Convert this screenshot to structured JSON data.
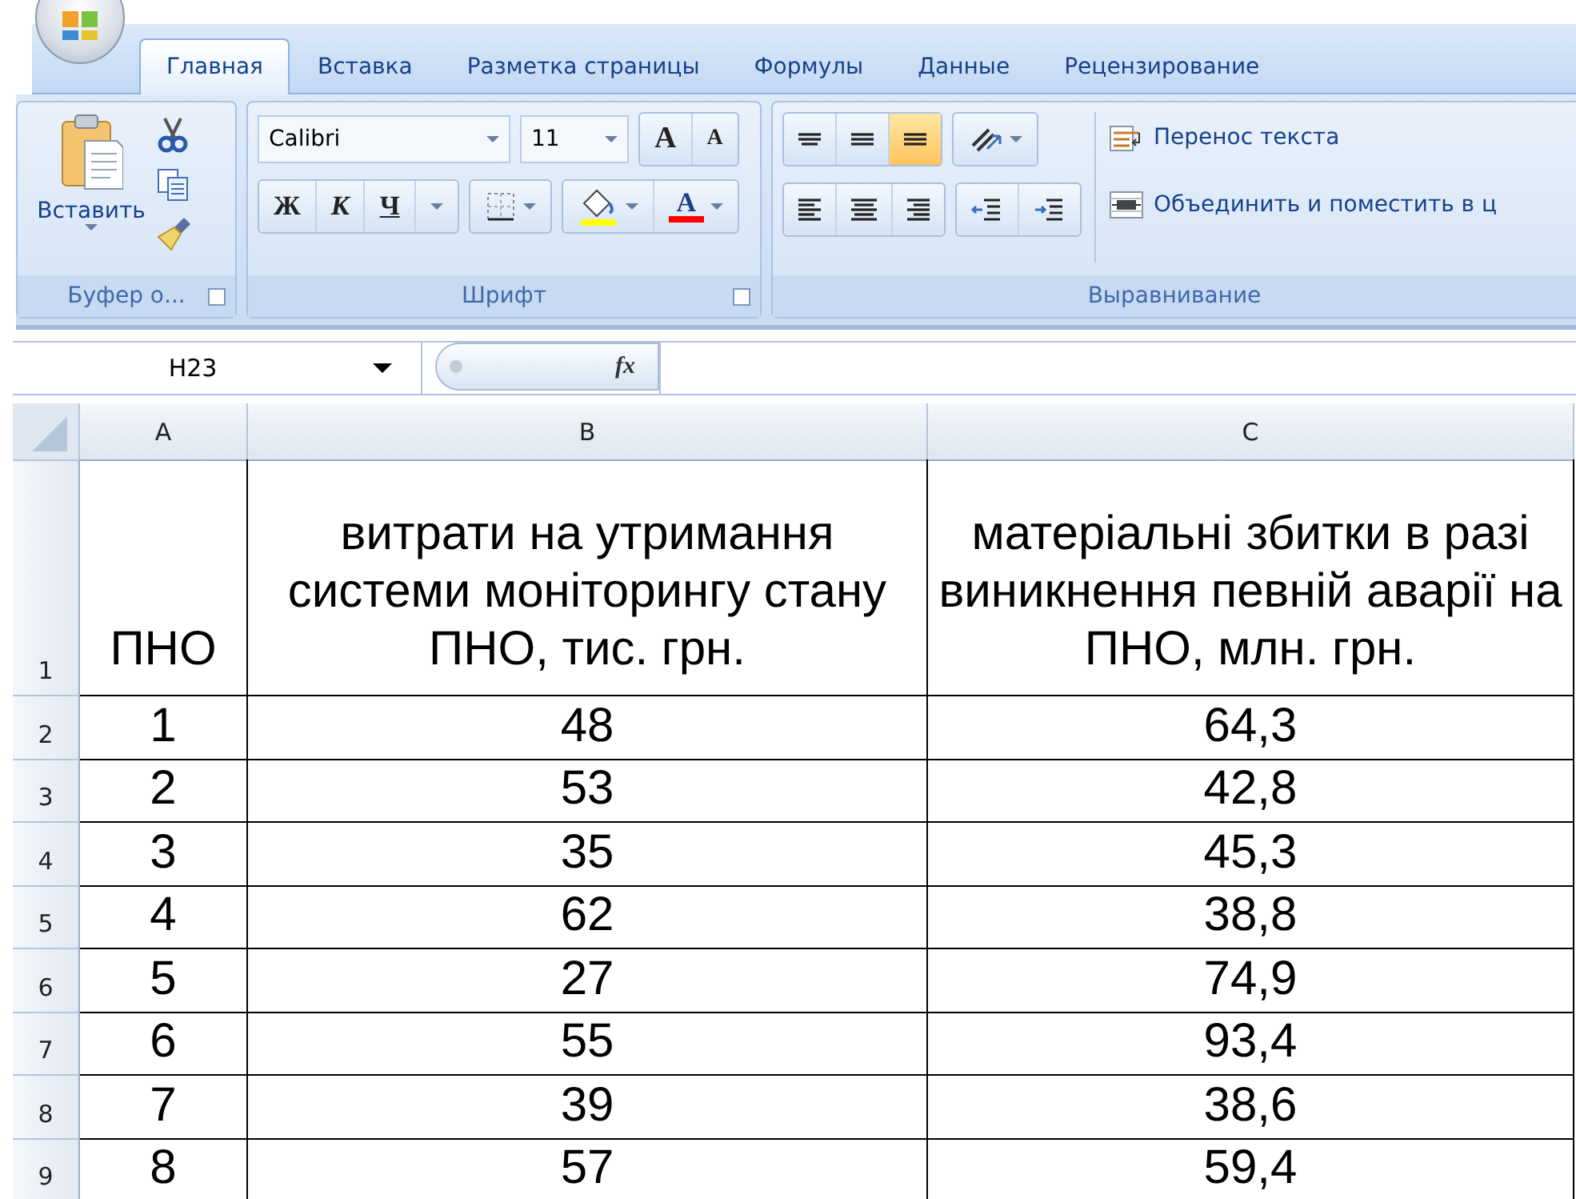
{
  "tabs": [
    {
      "label": "Главная",
      "selected": true
    },
    {
      "label": "Вставка",
      "selected": false
    },
    {
      "label": "Разметка страницы",
      "selected": false
    },
    {
      "label": "Формулы",
      "selected": false
    },
    {
      "label": "Данные",
      "selected": false
    },
    {
      "label": "Рецензирование",
      "selected": false
    }
  ],
  "ribbon": {
    "clipboard": {
      "title": "Буфер о...",
      "paste_label": "Вставить"
    },
    "font": {
      "title": "Шрифт",
      "font_name": "Calibri",
      "font_size": "11",
      "grow_font": "A",
      "shrink_font": "A",
      "bold": "Ж",
      "italic": "К",
      "underline": "Ч",
      "font_color": "A"
    },
    "alignment": {
      "title": "Выравнивание",
      "vertical": [
        {
          "kind": "top",
          "selected": false
        },
        {
          "kind": "middle",
          "selected": false
        },
        {
          "kind": "bottom",
          "selected": true
        }
      ],
      "horizontal": [
        {
          "kind": "left",
          "selected": false
        },
        {
          "kind": "center",
          "selected": false
        },
        {
          "kind": "right",
          "selected": false
        }
      ],
      "wrap_text": "Перенос текста",
      "merge": "Объединить и поместить в ц"
    }
  },
  "formula_bar": {
    "name_box": "H23",
    "fx": "fx"
  },
  "sheet": {
    "columns": [
      "A",
      "B",
      "C"
    ],
    "rows": [
      {
        "number": "1",
        "cells": [
          "ПНО",
          "витрати на утримання системи моніторингу стану ПНО, тис. грн.",
          "матеріальні збитки в разі виникнення певній аварії на ПНО, млн. грн."
        ]
      },
      {
        "number": "2",
        "cells": [
          "1",
          "48",
          "64,3"
        ]
      },
      {
        "number": "3",
        "cells": [
          "2",
          "53",
          "42,8"
        ]
      },
      {
        "number": "4",
        "cells": [
          "3",
          "35",
          "45,3"
        ]
      },
      {
        "number": "5",
        "cells": [
          "4",
          "62",
          "38,8"
        ]
      },
      {
        "number": "6",
        "cells": [
          "5",
          "27",
          "74,9"
        ]
      },
      {
        "number": "7",
        "cells": [
          "6",
          "55",
          "93,4"
        ]
      },
      {
        "number": "8",
        "cells": [
          "7",
          "39",
          "38,6"
        ]
      },
      {
        "number": "9",
        "cells": [
          "8",
          "57",
          "59,4"
        ]
      }
    ]
  }
}
